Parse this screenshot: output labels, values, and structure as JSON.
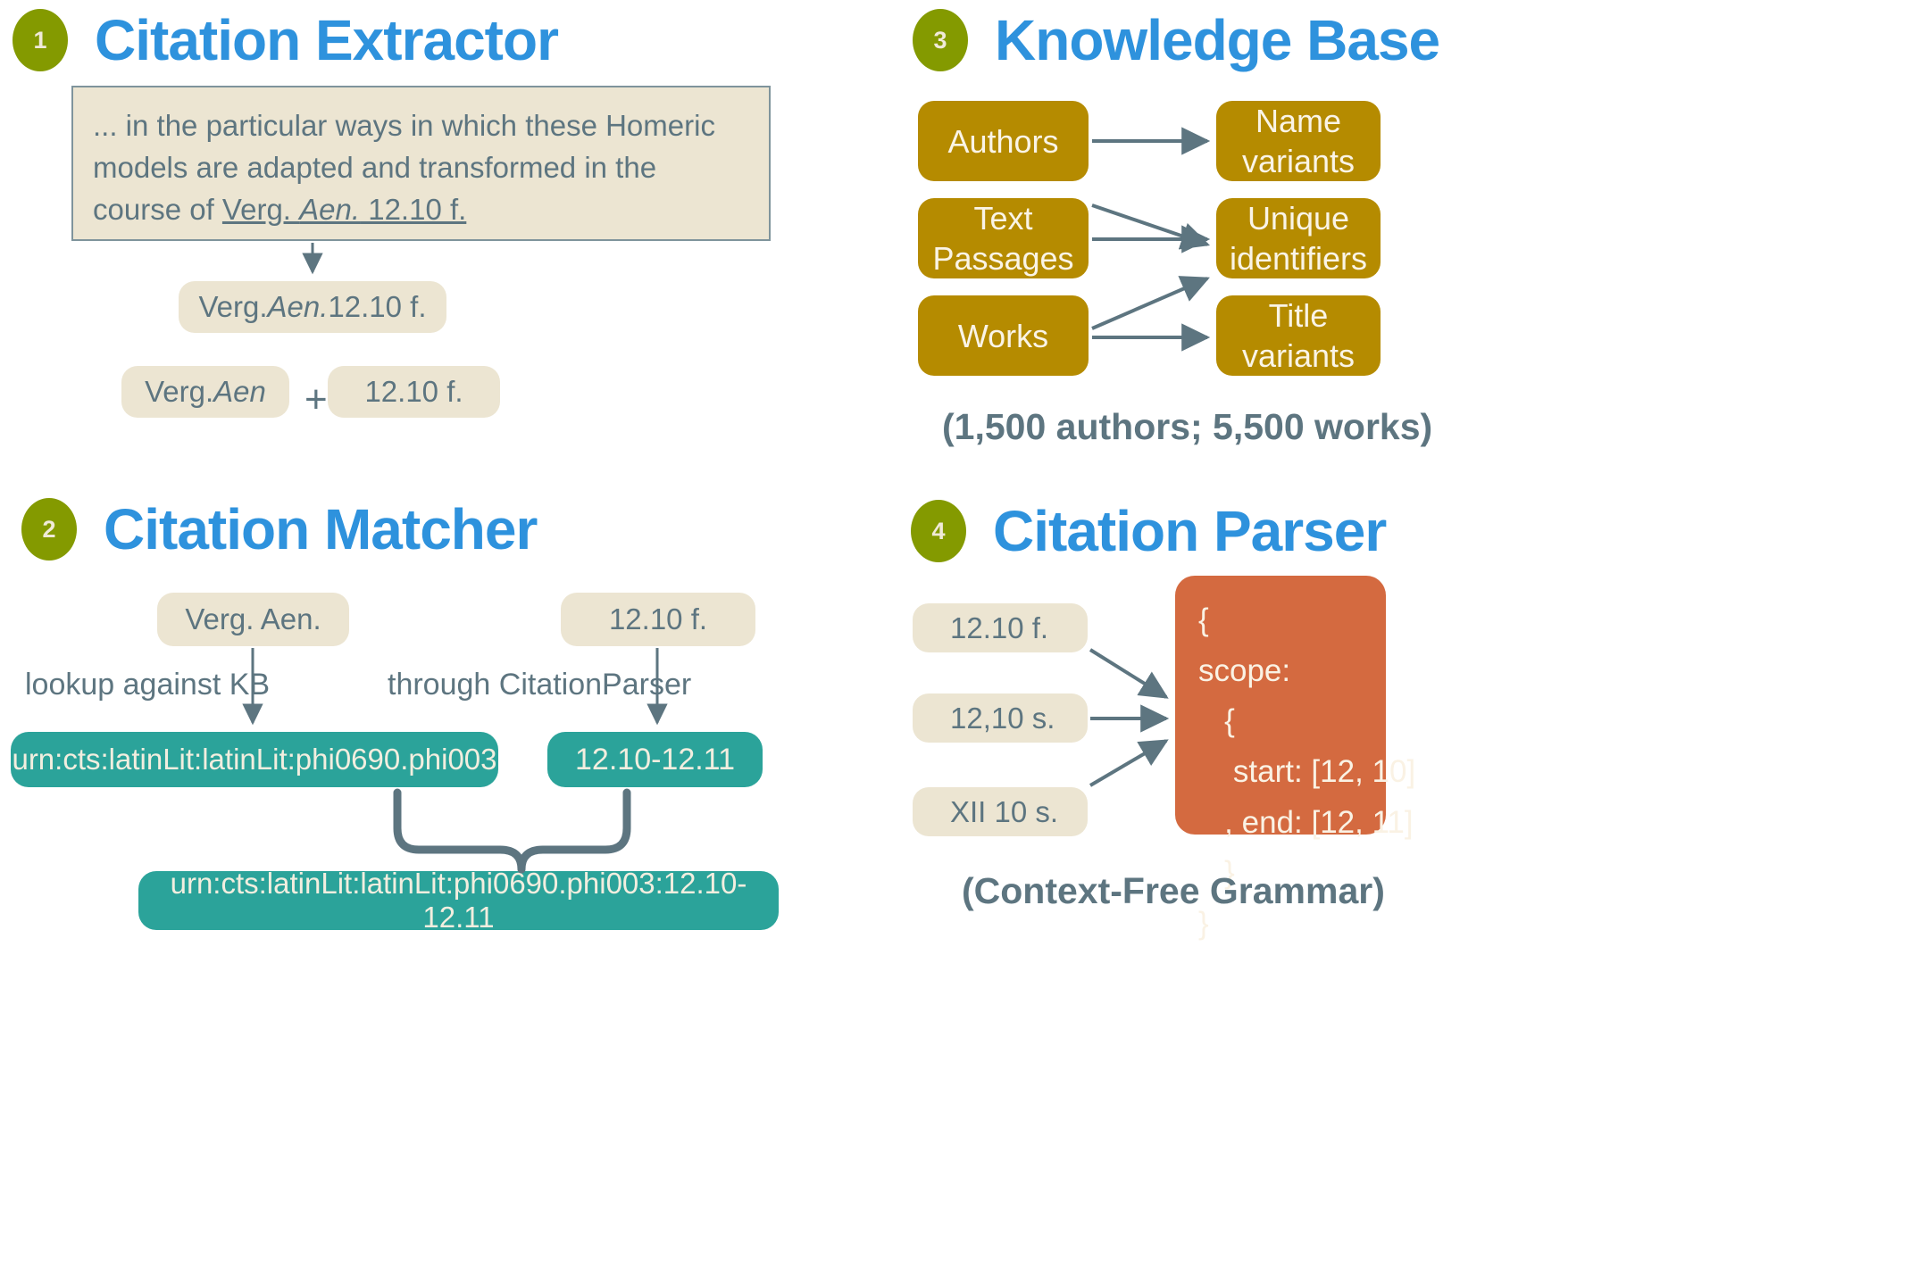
{
  "colors": {
    "badge_green": "#849a00",
    "title_blue": "#2e92dd",
    "beige": "#ece5d2",
    "teal": "#2ba39a",
    "gold": "#b58b00",
    "orange": "#d46a40",
    "slate": "#5d7580"
  },
  "sections": {
    "extractor": {
      "number": "1",
      "title": "Citation Extractor",
      "quote": {
        "prefix": "... in the particular ways in which these Homeric models are adapted and transformed in the course of ",
        "citation_part1": "Verg. ",
        "citation_part2": "Aen.",
        "citation_part3": " 12.10 f."
      },
      "extracted": {
        "author": "Verg. ",
        "work": "Aen.",
        "scope": " 12.10 f."
      },
      "split_left": {
        "author": "Verg. ",
        "work": "Aen"
      },
      "plus": "+",
      "split_right": "12.10 f."
    },
    "matcher": {
      "number": "2",
      "title": "Citation Matcher",
      "input_left": "Verg. Aen.",
      "input_right": "12.10 f.",
      "edge_label_left": "lookup against KB",
      "edge_label_right": "through CitationParser",
      "output_left": "urn:cts:latinLit:latinLit:phi0690.phi003",
      "output_right": "12.10-12.11",
      "merged_output": "urn:cts:latinLit:latinLit:phi0690.phi003:12.10-12.11"
    },
    "knowledge_base": {
      "number": "3",
      "title": "Knowledge Base",
      "left_nodes": [
        "Authors",
        "Text\nPassages",
        "Works"
      ],
      "right_nodes": [
        "Name\nvariants",
        "Unique\nidentifiers",
        "Title\nvariants"
      ],
      "caption": "(1,500 authors; 5,500 works)"
    },
    "parser": {
      "number": "4",
      "title": "Citation Parser",
      "inputs": [
        "12.10 f.",
        "12,10 s.",
        "XII 10 s."
      ],
      "output": "{\nscope:\n   {\n    start: [12, 10]\n   , end: [12, 11]\n   }\n}",
      "caption": "(Context-Free Grammar)"
    }
  }
}
